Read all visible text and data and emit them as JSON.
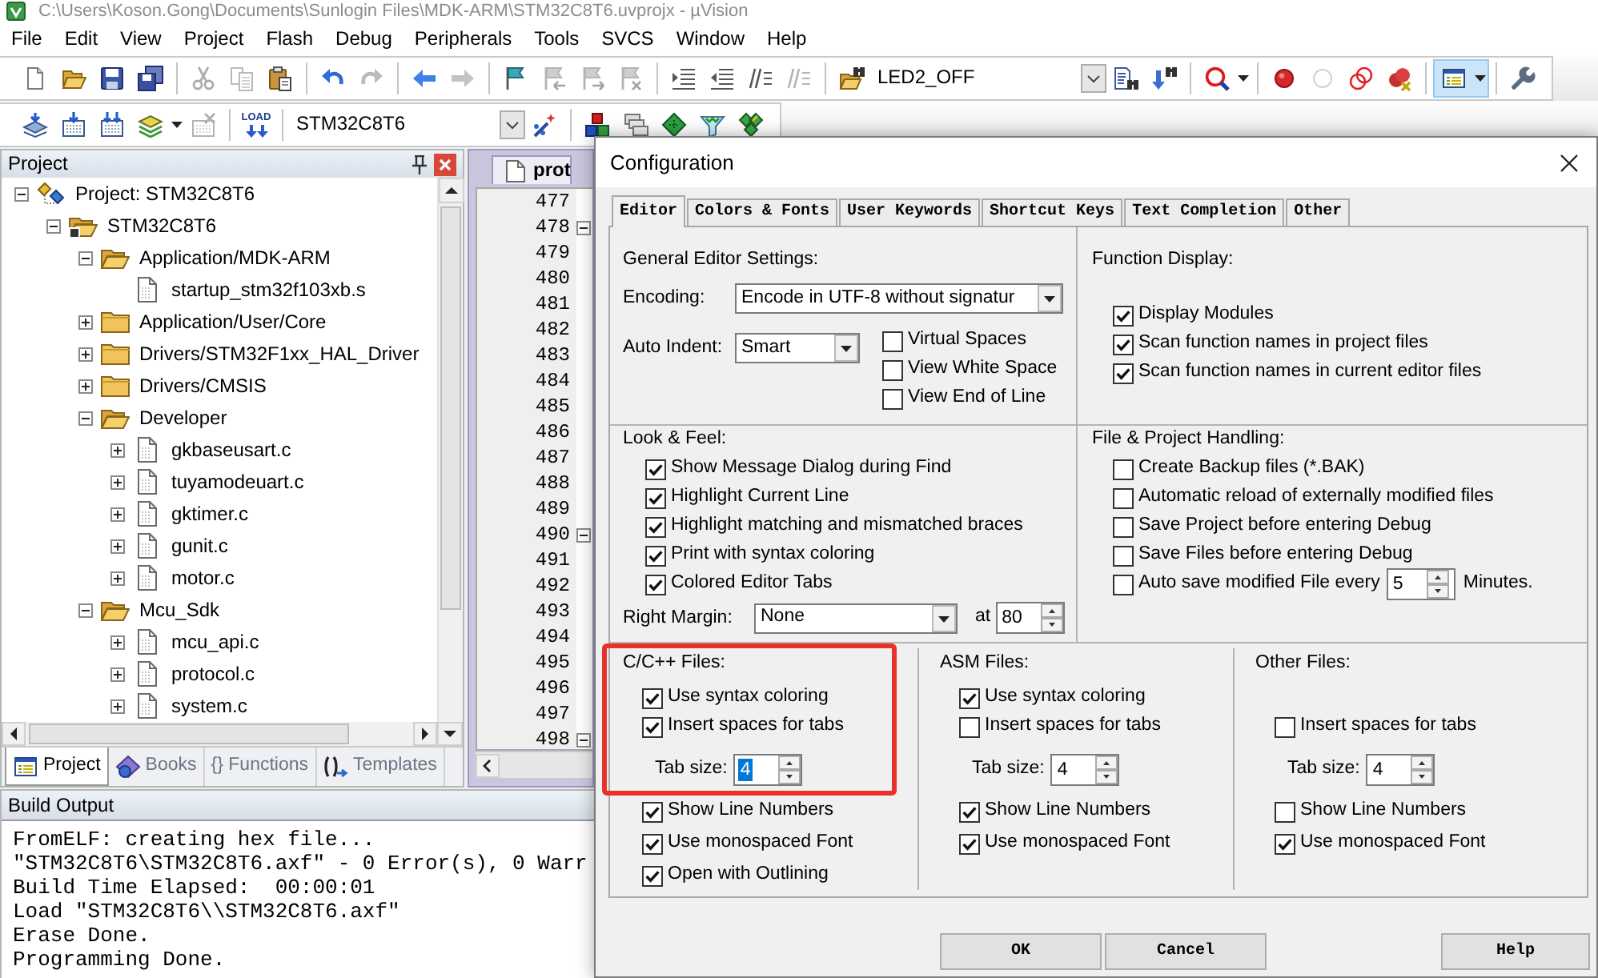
{
  "window": {
    "title": "C:\\Users\\Koson.Gong\\Documents\\Sunlogin Files\\MDK-ARM\\STM32C8T6.uvprojx - µVision"
  },
  "menu": [
    "File",
    "Edit",
    "View",
    "Project",
    "Flash",
    "Debug",
    "Peripherals",
    "Tools",
    "SVCS",
    "Window",
    "Help"
  ],
  "toolbar_1": [
    {
      "kind": "new",
      "disabled": false,
      "pressed": false
    },
    {
      "kind": "open",
      "disabled": false,
      "pressed": false
    },
    {
      "kind": "save",
      "disabled": false,
      "pressed": false
    },
    {
      "kind": "save_all",
      "disabled": false,
      "pressed": false
    },
    {
      "kind": "separator"
    },
    {
      "kind": "cut",
      "disabled": true,
      "pressed": false
    },
    {
      "kind": "copy",
      "disabled": true,
      "pressed": false
    },
    {
      "kind": "paste",
      "disabled": false,
      "pressed": false
    },
    {
      "kind": "separator"
    },
    {
      "kind": "undo",
      "disabled": false,
      "pressed": false
    },
    {
      "kind": "redo",
      "disabled": true,
      "pressed": false
    },
    {
      "kind": "separator"
    },
    {
      "kind": "back",
      "disabled": false,
      "pressed": false
    },
    {
      "kind": "forward",
      "disabled": true,
      "pressed": false
    },
    {
      "kind": "separator"
    },
    {
      "kind": "bookmark",
      "disabled": false,
      "pressed": false
    },
    {
      "kind": "bookmark_prev",
      "disabled": true,
      "pressed": false
    },
    {
      "kind": "bookmark_next",
      "disabled": true,
      "pressed": false
    },
    {
      "kind": "bookmark_clear",
      "disabled": true,
      "pressed": false
    },
    {
      "kind": "separator"
    },
    {
      "kind": "indent",
      "disabled": false,
      "pressed": false
    },
    {
      "kind": "unindent",
      "disabled": false,
      "pressed": false
    },
    {
      "kind": "comment",
      "disabled": false,
      "pressed": false
    },
    {
      "kind": "uncomment",
      "disabled": true,
      "pressed": false
    },
    {
      "kind": "separator"
    },
    {
      "kind": "find_in_files",
      "disabled": false,
      "pressed": false
    },
    {
      "kind": "combo",
      "value": "LED2_OFF"
    },
    {
      "kind": "find",
      "disabled": false,
      "pressed": false
    },
    {
      "kind": "incremental_find",
      "disabled": false,
      "pressed": false
    },
    {
      "kind": "separator"
    },
    {
      "kind": "debug",
      "disabled": false,
      "pressed": false,
      "dropdown": true
    },
    {
      "kind": "separator"
    },
    {
      "kind": "breakpoint",
      "disabled": false,
      "pressed": false
    },
    {
      "kind": "breakpoint_enable",
      "disabled": true,
      "pressed": false
    },
    {
      "kind": "breakpoint_disable",
      "disabled": false,
      "pressed": false
    },
    {
      "kind": "breakpoint_kill",
      "disabled": false,
      "pressed": false
    },
    {
      "kind": "separator"
    },
    {
      "kind": "window_layout",
      "disabled": false,
      "pressed": true,
      "dropdown": true
    },
    {
      "kind": "separator"
    },
    {
      "kind": "settings",
      "disabled": false,
      "pressed": false
    }
  ],
  "toolbar_2": [
    {
      "kind": "translate",
      "disabled": false,
      "pressed": false
    },
    {
      "kind": "build",
      "disabled": false,
      "pressed": false
    },
    {
      "kind": "rebuild",
      "disabled": false,
      "pressed": false
    },
    {
      "kind": "batch_build",
      "disabled": false,
      "pressed": false,
      "dropdown": true
    },
    {
      "kind": "stop_build",
      "disabled": true,
      "pressed": false
    },
    {
      "kind": "separator"
    },
    {
      "kind": "download",
      "label": "LOAD",
      "disabled": false,
      "pressed": false
    },
    {
      "kind": "separator"
    },
    {
      "kind": "combo",
      "value": "STM32C8T6"
    },
    {
      "kind": "target_options",
      "disabled": false,
      "pressed": false
    },
    {
      "kind": "separator"
    },
    {
      "kind": "blocks",
      "disabled": false,
      "pressed": false
    },
    {
      "kind": "stacked_windows",
      "disabled": false,
      "pressed": false
    },
    {
      "kind": "green_diamond",
      "disabled": false,
      "pressed": false
    },
    {
      "kind": "funnel",
      "disabled": false,
      "pressed": false
    },
    {
      "kind": "diamond_cluster",
      "disabled": false,
      "pressed": false
    }
  ],
  "project_panel": {
    "title": "Project",
    "tree": [
      {
        "kind": "project",
        "label": "Project: STM32C8T6",
        "expanded": true,
        "children": [
          {
            "kind": "target",
            "label": "STM32C8T6",
            "expanded": true,
            "children": [
              {
                "kind": "group",
                "label": "Application/MDK-ARM",
                "expanded": true,
                "children": [
                  {
                    "kind": "file",
                    "label": "startup_stm32f103xb.s"
                  }
                ]
              },
              {
                "kind": "group",
                "label": "Application/User/Core",
                "expanded": false
              },
              {
                "kind": "group",
                "label": "Drivers/STM32F1xx_HAL_Driver",
                "expanded": false
              },
              {
                "kind": "group",
                "label": "Drivers/CMSIS",
                "expanded": false
              },
              {
                "kind": "group",
                "label": "Developer",
                "expanded": true,
                "children": [
                  {
                    "kind": "file",
                    "label": "gkbaseusart.c",
                    "expanded": false
                  },
                  {
                    "kind": "file",
                    "label": "tuyamodeuart.c",
                    "expanded": false
                  },
                  {
                    "kind": "file",
                    "label": "gktimer.c",
                    "expanded": false
                  },
                  {
                    "kind": "file",
                    "label": "gunit.c",
                    "expanded": false
                  },
                  {
                    "kind": "file",
                    "label": "motor.c",
                    "expanded": false
                  }
                ]
              },
              {
                "kind": "group",
                "label": "Mcu_Sdk",
                "expanded": true,
                "children": [
                  {
                    "kind": "file",
                    "label": "mcu_api.c",
                    "expanded": false
                  },
                  {
                    "kind": "file",
                    "label": "protocol.c",
                    "expanded": false
                  },
                  {
                    "kind": "file",
                    "label": "system.c",
                    "expanded": false
                  }
                ]
              }
            ]
          }
        ]
      }
    ],
    "tabs": [
      {
        "kind": "project",
        "label": "Project",
        "selected": true
      },
      {
        "kind": "books",
        "label": "Books",
        "selected": false
      },
      {
        "kind": "functions",
        "glyph": "{}",
        "label": "Functions",
        "selected": false
      },
      {
        "kind": "templates",
        "label": "Templates",
        "selected": false
      }
    ]
  },
  "editor": {
    "tab": "prot",
    "lines": [
      {
        "number": "477",
        "fold": false
      },
      {
        "number": "478",
        "fold": true
      },
      {
        "number": "479",
        "fold": false
      },
      {
        "number": "480",
        "fold": false
      },
      {
        "number": "481",
        "fold": false
      },
      {
        "number": "482",
        "fold": false
      },
      {
        "number": "483",
        "fold": false
      },
      {
        "number": "484",
        "fold": false
      },
      {
        "number": "485",
        "fold": false
      },
      {
        "number": "486",
        "fold": false
      },
      {
        "number": "487",
        "fold": false
      },
      {
        "number": "488",
        "fold": false
      },
      {
        "number": "489",
        "fold": false
      },
      {
        "number": "490",
        "fold": true
      },
      {
        "number": "491",
        "fold": false
      },
      {
        "number": "492",
        "fold": false
      },
      {
        "number": "493",
        "fold": false
      },
      {
        "number": "494",
        "fold": false
      },
      {
        "number": "495",
        "fold": false
      },
      {
        "number": "496",
        "fold": false
      },
      {
        "number": "497",
        "fold": false
      },
      {
        "number": "498",
        "fold": true
      }
    ]
  },
  "build_output": {
    "title": "Build Output",
    "lines": [
      "FromELF: creating hex file...",
      "\"STM32C8T6\\STM32C8T6.axf\" - 0 Error(s), 0 Warr",
      "Build Time Elapsed:  00:00:01",
      "Load \"STM32C8T6\\\\STM32C8T6.axf\"",
      "Erase Done.",
      "Programming Done."
    ]
  },
  "dialog": {
    "title": "Configuration",
    "tabs": [
      {
        "label": "Editor",
        "selected": true
      },
      {
        "label": "Colors & Fonts",
        "selected": false
      },
      {
        "label": "User Keywords",
        "selected": false
      },
      {
        "label": "Shortcut Keys",
        "selected": false
      },
      {
        "label": "Text Completion",
        "selected": false
      },
      {
        "label": "Other",
        "selected": false
      }
    ],
    "general": {
      "title": "General Editor Settings:",
      "encoding": {
        "label": "Encoding:",
        "value": "Encode in UTF-8 without signatur"
      },
      "auto_indent": {
        "label": "Auto Indent:",
        "value": "Smart"
      },
      "options": [
        {
          "label": "Virtual Spaces",
          "checked": false
        },
        {
          "label": "View White Space",
          "checked": false
        },
        {
          "label": "View End of Line",
          "checked": false
        }
      ]
    },
    "function_display": {
      "title": "Function Display:",
      "options": [
        {
          "label": "Display Modules",
          "checked": true
        },
        {
          "label": "Scan function names in project files",
          "checked": true
        },
        {
          "label": "Scan function names in current editor files",
          "checked": true
        }
      ]
    },
    "look_and_feel": {
      "title": "Look & Feel:",
      "options": [
        {
          "label": "Show Message Dialog during Find",
          "checked": true
        },
        {
          "label": "Highlight Current Line",
          "checked": true
        },
        {
          "label": "Highlight matching and mismatched braces",
          "checked": true
        },
        {
          "label": "Print with syntax coloring",
          "checked": true
        },
        {
          "label": "Colored Editor Tabs",
          "checked": true
        }
      ],
      "right_margin": {
        "label": "Right Margin:",
        "value": "None",
        "at_label": "at",
        "column": "80"
      }
    },
    "file_handling": {
      "title": "File & Project Handling:",
      "options": [
        {
          "label": "Create Backup files (*.BAK)",
          "checked": false
        },
        {
          "label": "Automatic reload of externally modified files",
          "checked": false
        },
        {
          "label": "Save Project before entering Debug",
          "checked": false
        },
        {
          "label": "Save Files before entering Debug",
          "checked": false
        }
      ],
      "auto_save": {
        "label": "Auto save modified File every",
        "checked": false,
        "value": "5",
        "unit": "Minutes."
      }
    },
    "file_types": [
      {
        "title": "C/C++ Files:",
        "highlighted": true,
        "options_top": [
          {
            "label": "Use syntax coloring",
            "checked": true
          },
          {
            "label": "Insert spaces for tabs",
            "checked": true
          }
        ],
        "tab_size": {
          "label": "Tab size:",
          "value": "4",
          "selected": true
        },
        "options_bottom": [
          {
            "label": "Show Line Numbers",
            "checked": true
          },
          {
            "label": "Use monospaced Font",
            "checked": true
          },
          {
            "label": "Open with Outlining",
            "checked": true
          }
        ]
      },
      {
        "title": "ASM Files:",
        "highlighted": false,
        "options_top": [
          {
            "label": "Use syntax coloring",
            "checked": true
          },
          {
            "label": "Insert spaces for tabs",
            "checked": false
          }
        ],
        "tab_size": {
          "label": "Tab size:",
          "value": "4",
          "selected": false
        },
        "options_bottom": [
          {
            "label": "Show Line Numbers",
            "checked": true
          },
          {
            "label": "Use monospaced Font",
            "checked": true
          }
        ]
      },
      {
        "title": "Other Files:",
        "highlighted": false,
        "options_top": [
          {
            "label": "Insert spaces for tabs",
            "checked": false
          }
        ],
        "tab_size": {
          "label": "Tab size:",
          "value": "4",
          "selected": false
        },
        "options_bottom": [
          {
            "label": "Show Line Numbers",
            "checked": false
          },
          {
            "label": "Use monospaced Font",
            "checked": true
          }
        ]
      }
    ],
    "buttons": [
      "OK",
      "Cancel",
      "Help"
    ]
  }
}
